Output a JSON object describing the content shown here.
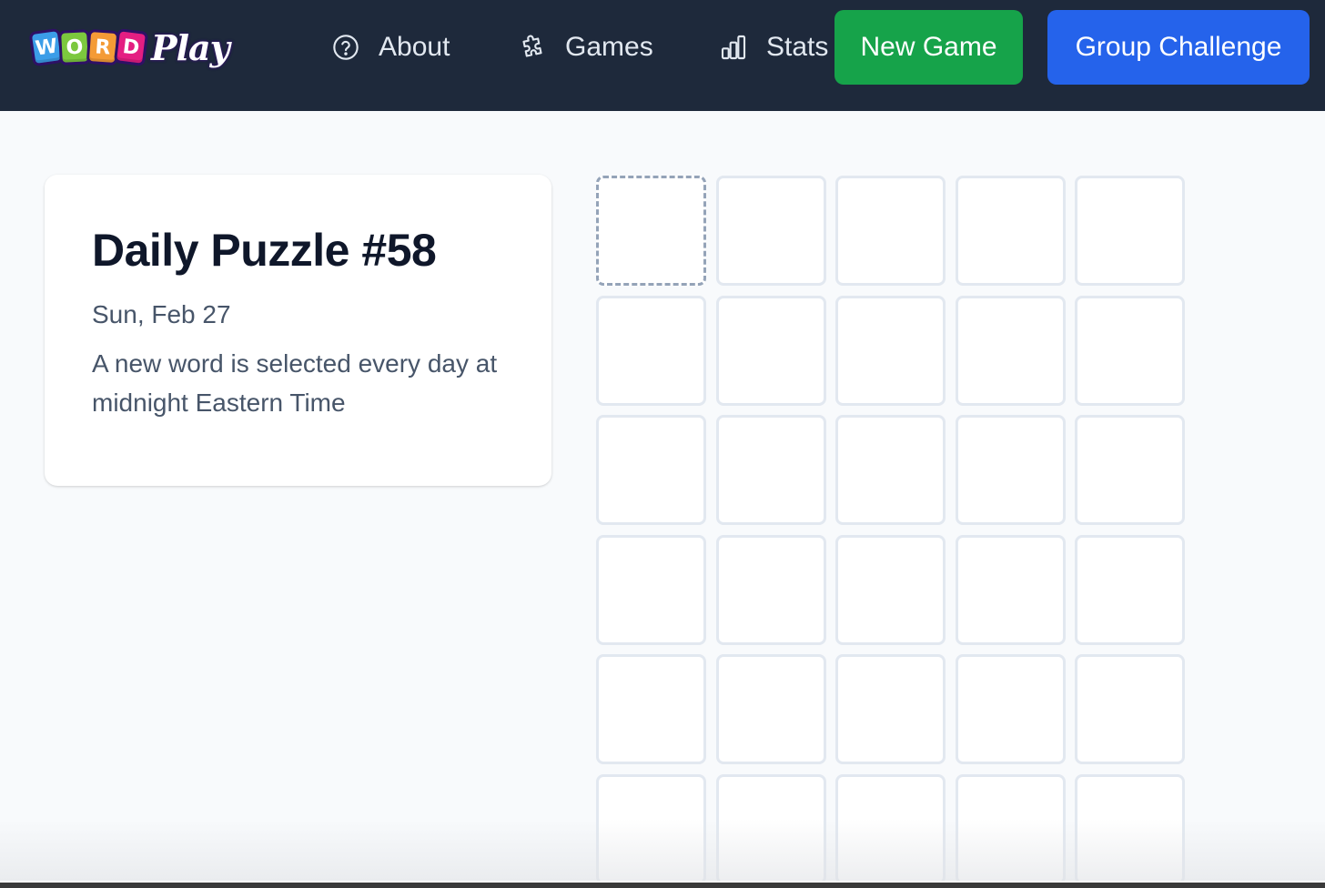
{
  "header": {
    "logo": {
      "letters": [
        "W",
        "O",
        "R",
        "D"
      ],
      "letter_colors": [
        "#3b9de8",
        "#7cc83e",
        "#f49b36",
        "#e41e82"
      ],
      "play_text": "Play"
    },
    "nav": [
      {
        "label": "About",
        "icon": "help-circle-icon"
      },
      {
        "label": "Games",
        "icon": "puzzle-icon"
      },
      {
        "label": "Stats",
        "icon": "bar-chart-icon"
      }
    ],
    "new_game_label": "New Game",
    "group_challenge_label": "Group Challenge",
    "colors": {
      "background": "#1e293b",
      "new_game": "#16a34a",
      "group_challenge": "#2563eb"
    }
  },
  "puzzle_card": {
    "title": "Daily Puzzle #58",
    "date": "Sun, Feb 27",
    "description": "A new word is selected every day at midnight Eastern Time"
  },
  "board": {
    "rows": 6,
    "columns": 5,
    "active_tile": [
      0,
      0
    ],
    "letters": [
      [
        "",
        "",
        "",
        "",
        ""
      ],
      [
        "",
        "",
        "",
        "",
        ""
      ],
      [
        "",
        "",
        "",
        "",
        ""
      ],
      [
        "",
        "",
        "",
        "",
        ""
      ],
      [
        "",
        "",
        "",
        "",
        ""
      ],
      [
        "",
        "",
        "",
        "",
        ""
      ]
    ]
  }
}
